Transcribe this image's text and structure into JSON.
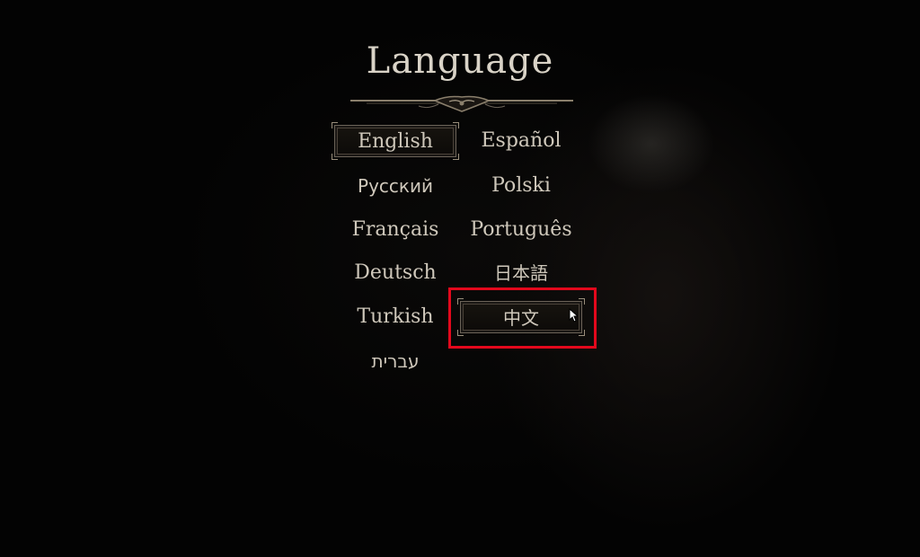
{
  "title": "Language",
  "languages": [
    {
      "label": "English",
      "selected": true
    },
    {
      "label": "Español"
    },
    {
      "label": "Русский"
    },
    {
      "label": "Polski"
    },
    {
      "label": "Français"
    },
    {
      "label": "Português"
    },
    {
      "label": "Deutsch"
    },
    {
      "label": "日本語"
    },
    {
      "label": "Turkish"
    },
    {
      "label": "中文",
      "hovered": true
    },
    {
      "label": "עברית"
    }
  ],
  "colors": {
    "text": "#cfc8bb",
    "title": "#d9d3c7",
    "highlight": "#e3081c",
    "frame": "#6b6358"
  },
  "icons": {
    "divider": "ornamental-divider-icon",
    "cursor": "mouse-pointer-icon"
  }
}
